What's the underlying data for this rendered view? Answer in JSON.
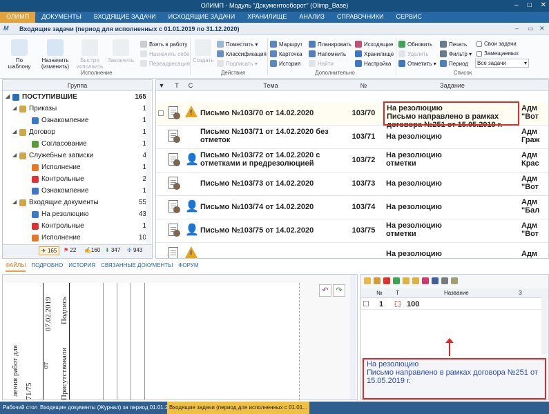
{
  "window": {
    "title": "ОЛИМП - Модуль \"Документооборот\" (Olimp_Base)"
  },
  "menu": [
    "ОЛИМП",
    "ДОКУМЕНТЫ",
    "ВХОДЯЩИЕ ЗАДАЧИ",
    "ИСХОДЯЩИЕ ЗАДАЧИ",
    "ХРАНИЛИЩЕ",
    "АНАЛИЗ",
    "СПРАВОЧНИКИ",
    "СЕРВИС"
  ],
  "doc_title": "Входящие задачи (период для исполненных с 01.01.2019 по 31.12.2020)",
  "ribbon": {
    "po_shablonu": "По шаблону",
    "naznachit": "Назначить (изменить)",
    "bystro": "Быстро исполнить",
    "zakonchit": "Закончить",
    "vzyat": "Взять в работу",
    "naznachit_sebe": "Назначить себе",
    "pereadresaciya": "Переадресация",
    "sozdat": "Создать",
    "pomestit": "Поместить",
    "klassifikaciya": "Классификация",
    "podpisat": "Подписать",
    "marshrut": "Маршрут",
    "kartochka": "Карточка",
    "istoriya": "История",
    "planirovat": "Планировать",
    "napomnit": "Напомнить",
    "nayti": "Найти",
    "ishodyaschie": "Исходящие",
    "hranilische": "Хранилище",
    "nastroyka": "Настройка",
    "obnovit": "Обновить",
    "udalit": "Удалить",
    "otmetit": "Отметить",
    "pechat": "Печать",
    "filtr": "Фильтр",
    "period": "Период",
    "svoi_zadachi": "Свои задачи",
    "zameschaemyh": "Замещаемых",
    "vse_zadachi": "Все задачи",
    "groups": {
      "ispolnenie": "Исполнение",
      "deystviya": "Действия",
      "dopolnitelno": "Дополнительно",
      "spisok": "Список"
    }
  },
  "tree": {
    "header": "Группа",
    "items": [
      {
        "label": "ПОСТУПИВШИЕ",
        "count": "165"
      },
      {
        "label": "Приказы",
        "count": "1"
      },
      {
        "label": "Ознакомление",
        "count": "1"
      },
      {
        "label": "Договор",
        "count": "1"
      },
      {
        "label": "Согласование",
        "count": "1"
      },
      {
        "label": "Служебные записки",
        "count": "4"
      },
      {
        "label": "Исполнение",
        "count": "1"
      },
      {
        "label": "Контрольные",
        "count": "2"
      },
      {
        "label": "Ознакомление",
        "count": "1"
      },
      {
        "label": "Входящие документы",
        "count": "55"
      },
      {
        "label": "На резолюцию",
        "count": "43"
      },
      {
        "label": "Контрольные",
        "count": "1"
      },
      {
        "label": "Исполнение",
        "count": "10"
      }
    ],
    "tabs": [
      "165",
      "22",
      "160",
      "347",
      "943"
    ]
  },
  "grid": {
    "headers": {
      "t": "Т",
      "c": "С",
      "tema": "Тема",
      "num": "№",
      "task": "Задание"
    },
    "rows": [
      {
        "title": "Письмо №103/70 от 14.02.2020",
        "num": "103/70",
        "task": "На резолюцию\nПисьмо направлено в рамках договора №251 от 15.05.2019 г.",
        "last": "Адм\n\"Вот"
      },
      {
        "title": "Письмо №103/71 от 14.02.2020 без отметок",
        "num": "103/71",
        "task": "На резолюцию",
        "last": "Адм\nГраж"
      },
      {
        "title": "Письмо №103/72 от 14.02.2020 с отметками и предрезолюцией",
        "num": "103/72",
        "task": "На резолюцию отметки",
        "last": "Адм\nКрас"
      },
      {
        "title": "Письмо №103/73 от 14.02.2020",
        "num": "103/73",
        "task": "На резолюцию",
        "last": "Адм\n\"Вот"
      },
      {
        "title": "Письмо №103/74 от 14.02.2020",
        "num": "103/74",
        "task": "На резолюцию",
        "last": "Адм\n\"Бал"
      },
      {
        "title": "Письмо №103/75 от 14.02.2020",
        "num": "103/75",
        "task": "На резолюцию отметки",
        "last": "Адм\n\"Вот"
      },
      {
        "title": "",
        "num": "",
        "task": "На резолюцию",
        "last": "Адм"
      }
    ]
  },
  "bottom_tabs": [
    "ФАЙЛЫ",
    "ПОДРОБНО",
    "ИСТОРИЯ",
    "СВЯЗАННЫЕ ДОКУМЕНТЫ",
    "ФОРУМ"
  ],
  "preview_text": {
    "date": "07.02.2019",
    "sign": "Подпись",
    "line1": "ления работ для",
    "line2": "471/75",
    "line3": "от",
    "line4": "Присутствовали"
  },
  "files": {
    "headers": {
      "no": "№",
      "t": "Т",
      "name": "Название",
      "z": "З"
    },
    "rows": [
      {
        "no": "1",
        "name": "100"
      }
    ]
  },
  "note": {
    "line1": "На резолюцию",
    "line2": "Письмо направлено в рамках договора №251 от 15.05.2019 г."
  },
  "taskbar": [
    "Рабочий стол",
    "Входящие документы (Журнал) за период 01.01.201...",
    "Входящие задачи (период для исполненных с 01.01..."
  ],
  "colors": {
    "accent": "#e3a23a",
    "highlight": "#e02a2a",
    "menu": "#2568a3"
  }
}
